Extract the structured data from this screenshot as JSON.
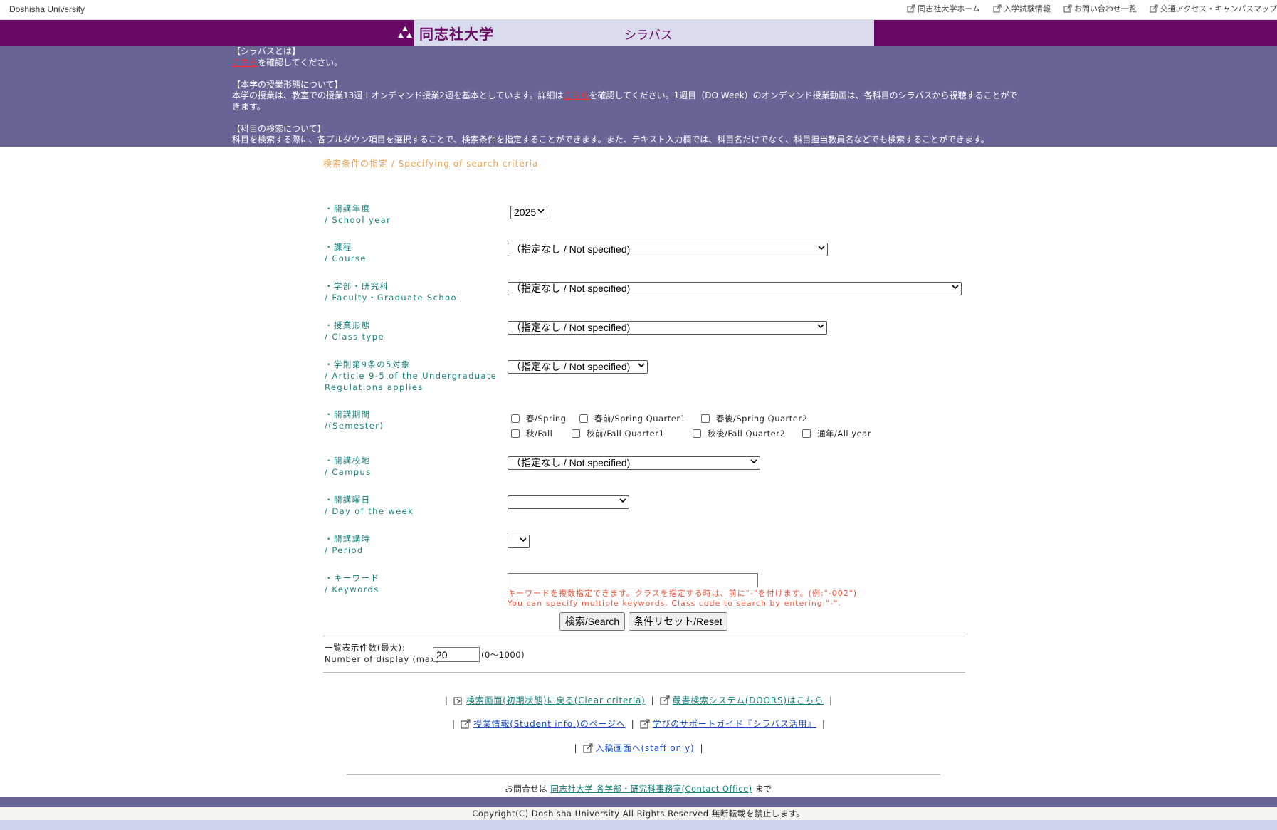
{
  "topbar": {
    "brand": "Doshisha University",
    "links": [
      {
        "label": "同志社大学ホーム",
        "icon": "external-link-icon"
      },
      {
        "label": "入学試験情報",
        "icon": "external-link-icon"
      },
      {
        "label": "お問い合わせ一覧",
        "icon": "external-link-icon"
      },
      {
        "label": "交通アクセス・キャンパスマップ",
        "icon": "external-link-icon"
      }
    ]
  },
  "header": {
    "university": "同志社大学",
    "title": "シラバス"
  },
  "info": {
    "about_heading": "【シラバスとは】",
    "about_link": "こちら",
    "about_text": "を確認してください。",
    "format_heading": "【本学の授業形態について】",
    "format_text_1": "本学の授業は、教室での授業13週＋オンデマンド授業2週を基本としています。詳細は",
    "format_link": "こちら",
    "format_text_2": "を確認してください。1週目（DO Week）のオンデマンド授業動画は、各科目のシラバスから視聴することがで",
    "format_text_3": "きます。",
    "search_heading": "【科目の検索について】",
    "search_text": "科目を検索する際に、各プルダウン項目を選択することで、検索条件を指定することができます。また、テキスト入力欄では、科目名だけでなく、科目担当教員名などでも検索することができます。"
  },
  "section_title": "検索条件の指定 / Specifying of search criteria",
  "form": {
    "year": {
      "label_ja": "・開講年度",
      "label_en": "/ School year",
      "value": "2025"
    },
    "course": {
      "label_ja": "・課程",
      "label_en": "/ Course",
      "value": "（指定なし / Not specified)"
    },
    "faculty": {
      "label_ja": "・学部・研究科",
      "label_en": "/ Faculty・Graduate School",
      "value": "（指定なし / Not specified)"
    },
    "class_type": {
      "label_ja": "・授業形態",
      "label_en": "/ Class type",
      "value": "（指定なし / Not specified)"
    },
    "article": {
      "label_ja": "・学則第9条の5対象",
      "label_en_1": "/ Article 9-5 of the Undergraduate",
      "label_en_2": "Regulations applies",
      "value": "（指定なし / Not specified)"
    },
    "semester": {
      "label_ja": "・開講期間",
      "label_en": "/(Semester)",
      "options": [
        "春/Spring",
        "春前/Spring Quarter1",
        "春後/Spring Quarter2",
        "秋/Fall",
        "秋前/Fall Quarter1",
        "秋後/Fall Quarter2",
        "通年/All year"
      ]
    },
    "campus": {
      "label_ja": "・開講校地",
      "label_en": "/ Campus",
      "value": "（指定なし / Not specified)"
    },
    "day": {
      "label_ja": "・開講曜日",
      "label_en": "/ Day of the week",
      "value": ""
    },
    "period": {
      "label_ja": "・開講講時",
      "label_en": "/ Period",
      "value": ""
    },
    "keyword": {
      "label_ja": "・キーワード",
      "label_en": "/ Keywords",
      "value": "",
      "note_ja": "キーワードを複数指定できます。クラスを指定する時は、前に\"-\"を付けます。(例:\"-002\")",
      "note_en": "You can specify multiple keywords. Class code to search by entering \"-\"."
    },
    "search_button": "検索/Search",
    "reset_button": "条件リセット/Reset",
    "display": {
      "label_1": "一覧表示件数(最大):",
      "label_2": "Number of display (max)",
      "value": "20",
      "range": "(0〜1000)"
    }
  },
  "links": {
    "clear": "検索画面(初期状態)に戻る(Clear criteria)",
    "doors": "蔵書検索システム(DOORS)はこちら",
    "student_info": "授業情報(Student info.)のページへ",
    "guide": "学びのサポートガイド『シラバス活用』",
    "staff": "入稿画面へ(staff only)"
  },
  "contact": {
    "prefix": "お問合せは",
    "link": "同志社大学 各学部・研究科事務室(Contact Office)",
    "suffix": "まで"
  },
  "copyright": "Copyright(C) Doshisha University All Rights Reserved.無断転載を禁止します。",
  "colors": {
    "header_purple": "#680a64",
    "info_band": "#676596",
    "label_green": "#16807a",
    "note_orange": "#e8553a",
    "link_red": "#ff2a2a"
  }
}
